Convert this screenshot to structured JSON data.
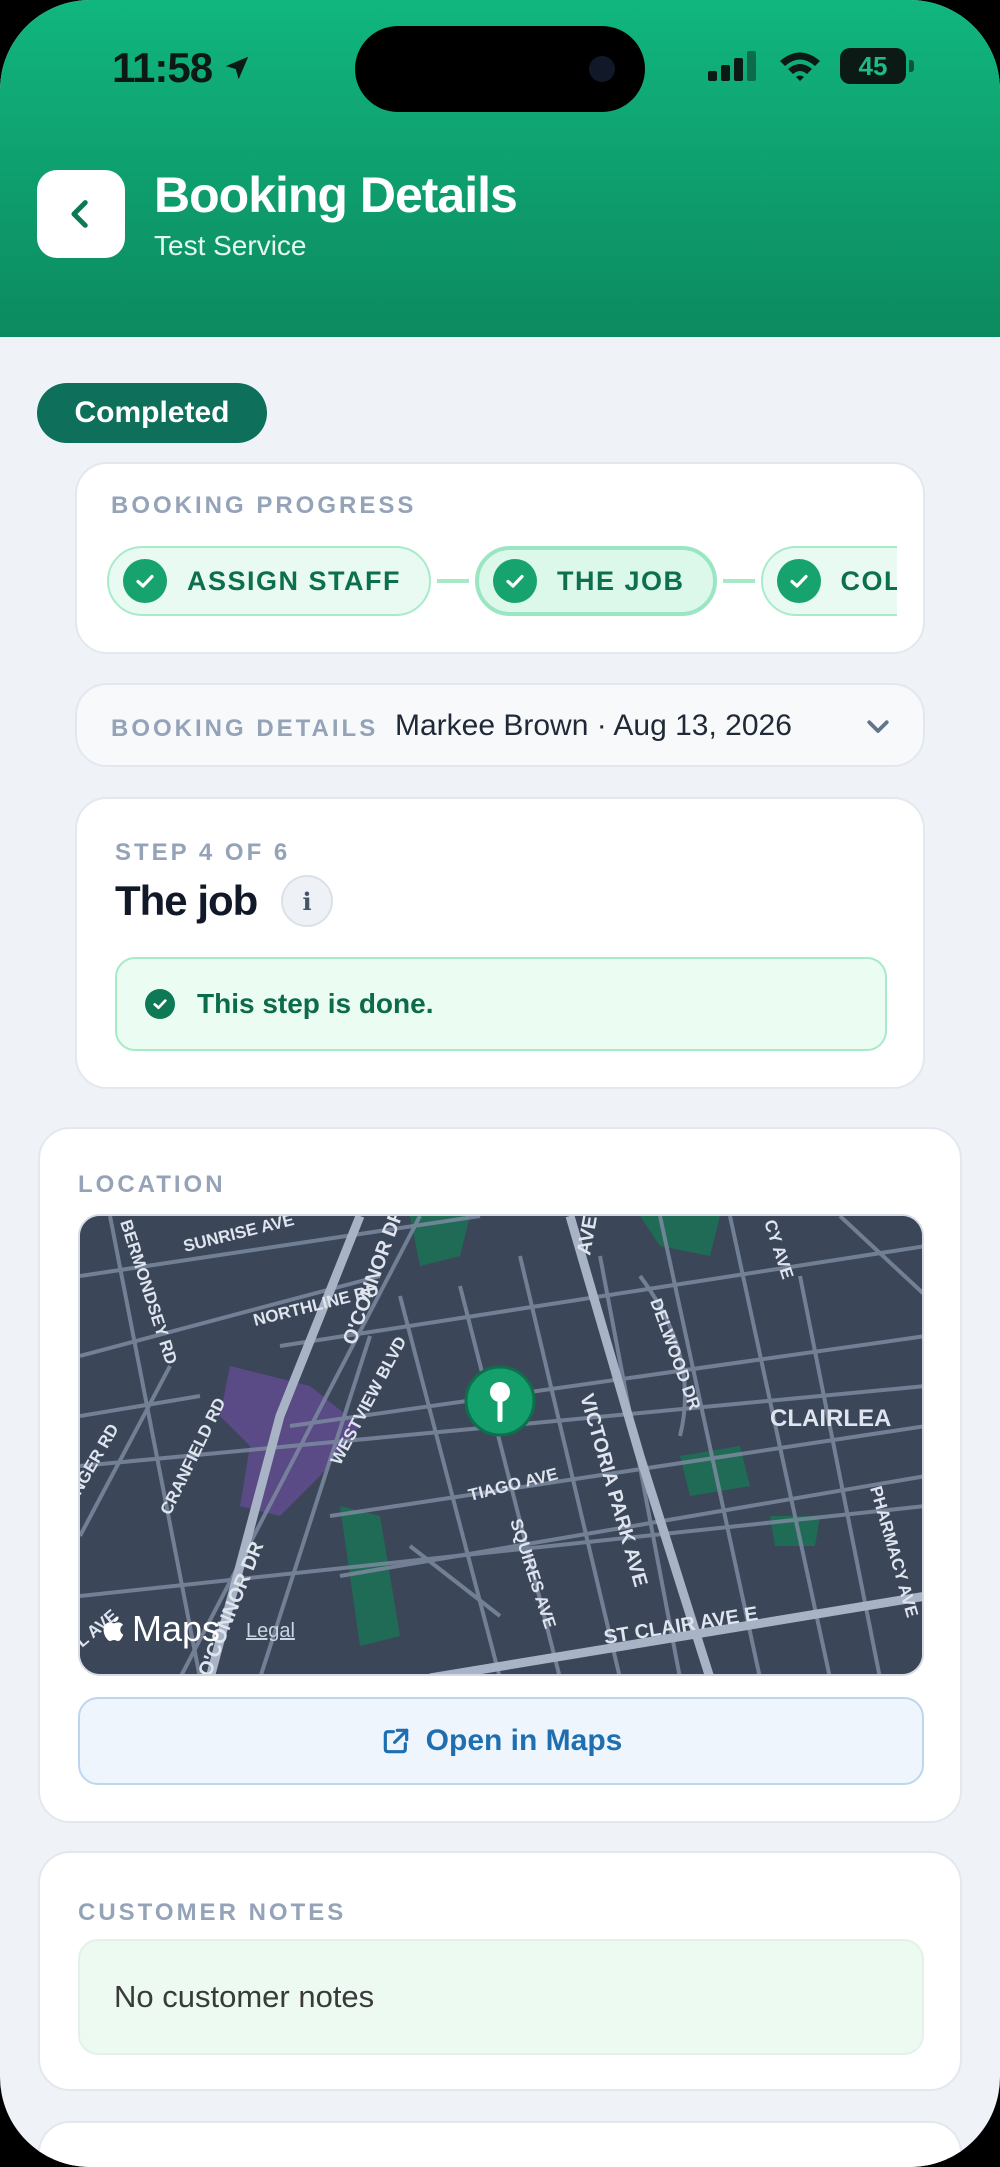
{
  "status_bar": {
    "time": "11:58",
    "battery": "45"
  },
  "header": {
    "title": "Booking Details",
    "subtitle": "Test Service"
  },
  "status_badge": "Completed",
  "progress": {
    "label": "BOOKING PROGRESS",
    "steps": [
      {
        "label": "ASSIGN STAFF",
        "state": "done"
      },
      {
        "label": "THE JOB",
        "state": "current"
      },
      {
        "label": "COLLECT",
        "state": "done"
      }
    ]
  },
  "booking_details": {
    "label": "BOOKING DETAILS",
    "summary": "Markee Brown · Aug 13, 2026"
  },
  "step": {
    "counter": "STEP 4 OF 6",
    "title": "The job",
    "info": "i",
    "done_message": "This step is done."
  },
  "location": {
    "label": "LOCATION",
    "map": {
      "logo": "Maps",
      "legal": "Legal",
      "streets": [
        "SUNRISE AVE",
        "BERMONDSEY RD",
        "NORTHLINE RD",
        "O'CONNOR DR",
        "CRANFIELD RD",
        "WESTVIEW BLVD",
        "TIAGO AVE",
        "SQUIRES AVE",
        "VICTORIA PARK AVE",
        "DELWOOD DR",
        "CLAIRLEA",
        "PHARMACY AVE",
        "ST CLAIR AVE E",
        "O'CONNOR DR",
        "AVE",
        "CY AVE",
        "NGER RD",
        "L AVE"
      ]
    },
    "open_maps_label": "Open in Maps"
  },
  "customer_notes": {
    "label": "CUSTOMER NOTES",
    "text": "No customer notes"
  },
  "colors": {
    "header_top": "#11b67f",
    "header_bottom": "#0c8a5f",
    "badge": "#0e6f5a",
    "success": "#16a36e",
    "link": "#1f6fb0"
  }
}
